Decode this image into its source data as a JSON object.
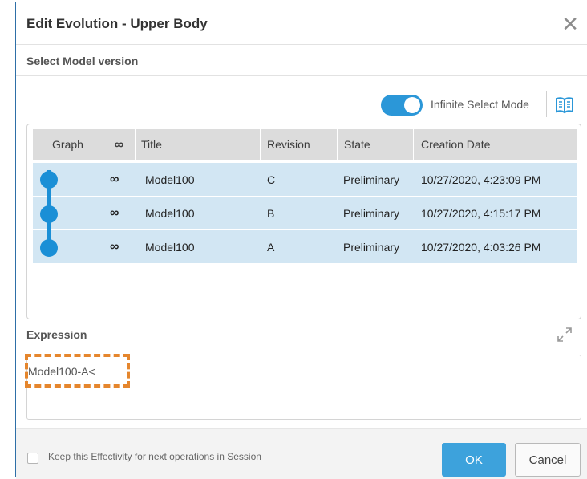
{
  "dialog": {
    "title": "Edit Evolution - Upper Body",
    "close_glyph": "✕",
    "subtitle": "Select Model version"
  },
  "toolbar": {
    "toggle_label": "Infinite Select Mode",
    "toggle_on": true,
    "book_icon": "book-icon"
  },
  "table": {
    "columns": [
      "Graph",
      "∞",
      "Title",
      "Revision",
      "State",
      "Creation Date"
    ],
    "rows": [
      {
        "inf": "∞",
        "title": "Model100",
        "revision": "C",
        "state": "Preliminary",
        "date": "10/27/2020, 4:23:09 PM"
      },
      {
        "inf": "∞",
        "title": "Model100",
        "revision": "B",
        "state": "Preliminary",
        "date": "10/27/2020, 4:15:17 PM"
      },
      {
        "inf": "∞",
        "title": "Model100",
        "revision": "A",
        "state": "Preliminary",
        "date": "10/27/2020, 4:03:26 PM"
      }
    ]
  },
  "expression": {
    "label": "Expression",
    "value": "Model100-A<"
  },
  "footer": {
    "checkbox_label": "Keep this Effectivity for next operations in Session",
    "ok_label": "OK",
    "cancel_label": "Cancel"
  },
  "colors": {
    "accent": "#2b97d8",
    "row_selected": "#d2e6f3",
    "highlight": "#e5862d"
  }
}
